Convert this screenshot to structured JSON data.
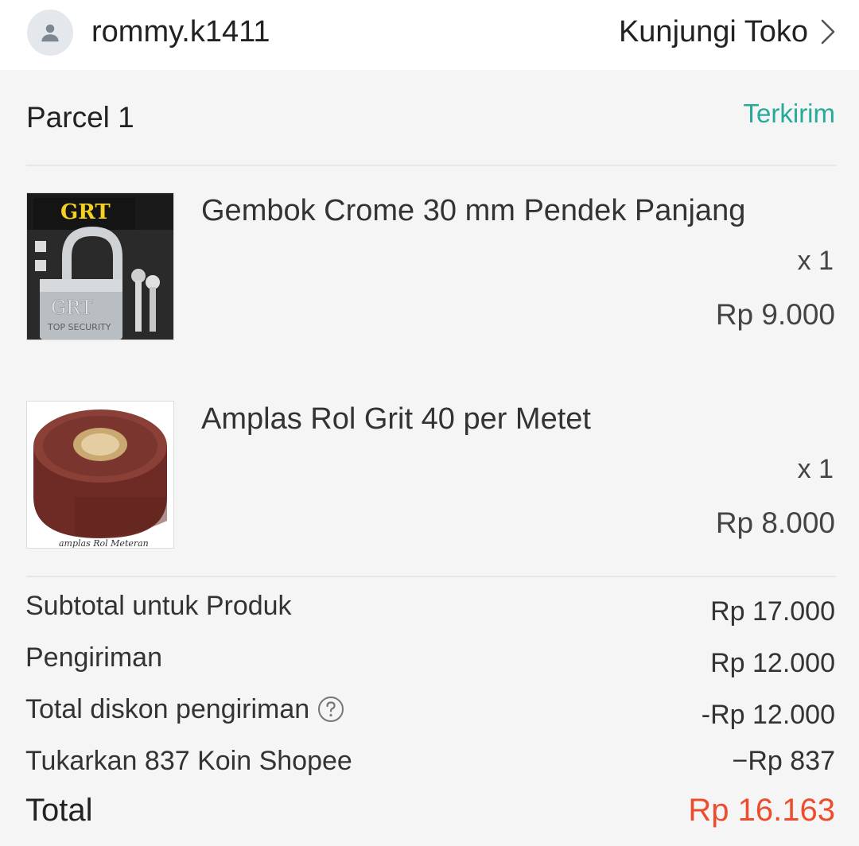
{
  "header": {
    "username": "rommy.k1411",
    "visit_store_label": "Kunjungi Toko",
    "avatar_icon": "user-avatar-icon"
  },
  "parcel": {
    "title": "Parcel 1",
    "status": "Terkirim",
    "status_color": "#26aa99"
  },
  "products": [
    {
      "name": "Gembok Crome 30 mm Pendek Panjang",
      "qty": "x 1",
      "price": "Rp 9.000",
      "image_brand": "GRT",
      "image_caption": "TOP SECURITY"
    },
    {
      "name": "Amplas Rol Grit 40 per Metet",
      "qty": "x 1",
      "price": "Rp 8.000",
      "image_caption": "amplas Rol Meteran"
    }
  ],
  "summary": {
    "subtotal_label": "Subtotal untuk Produk",
    "subtotal_value": "Rp 17.000",
    "shipping_label": "Pengiriman",
    "shipping_value": "Rp 12.000",
    "shipping_discount_label": "Total diskon pengiriman",
    "shipping_discount_value": "-Rp 12.000",
    "coins_label": "Tukarkan 837 Koin Shopee",
    "coins_value": "−Rp 837",
    "total_label": "Total",
    "total_value": "Rp 16.163",
    "total_color": "#ee4d2d"
  }
}
